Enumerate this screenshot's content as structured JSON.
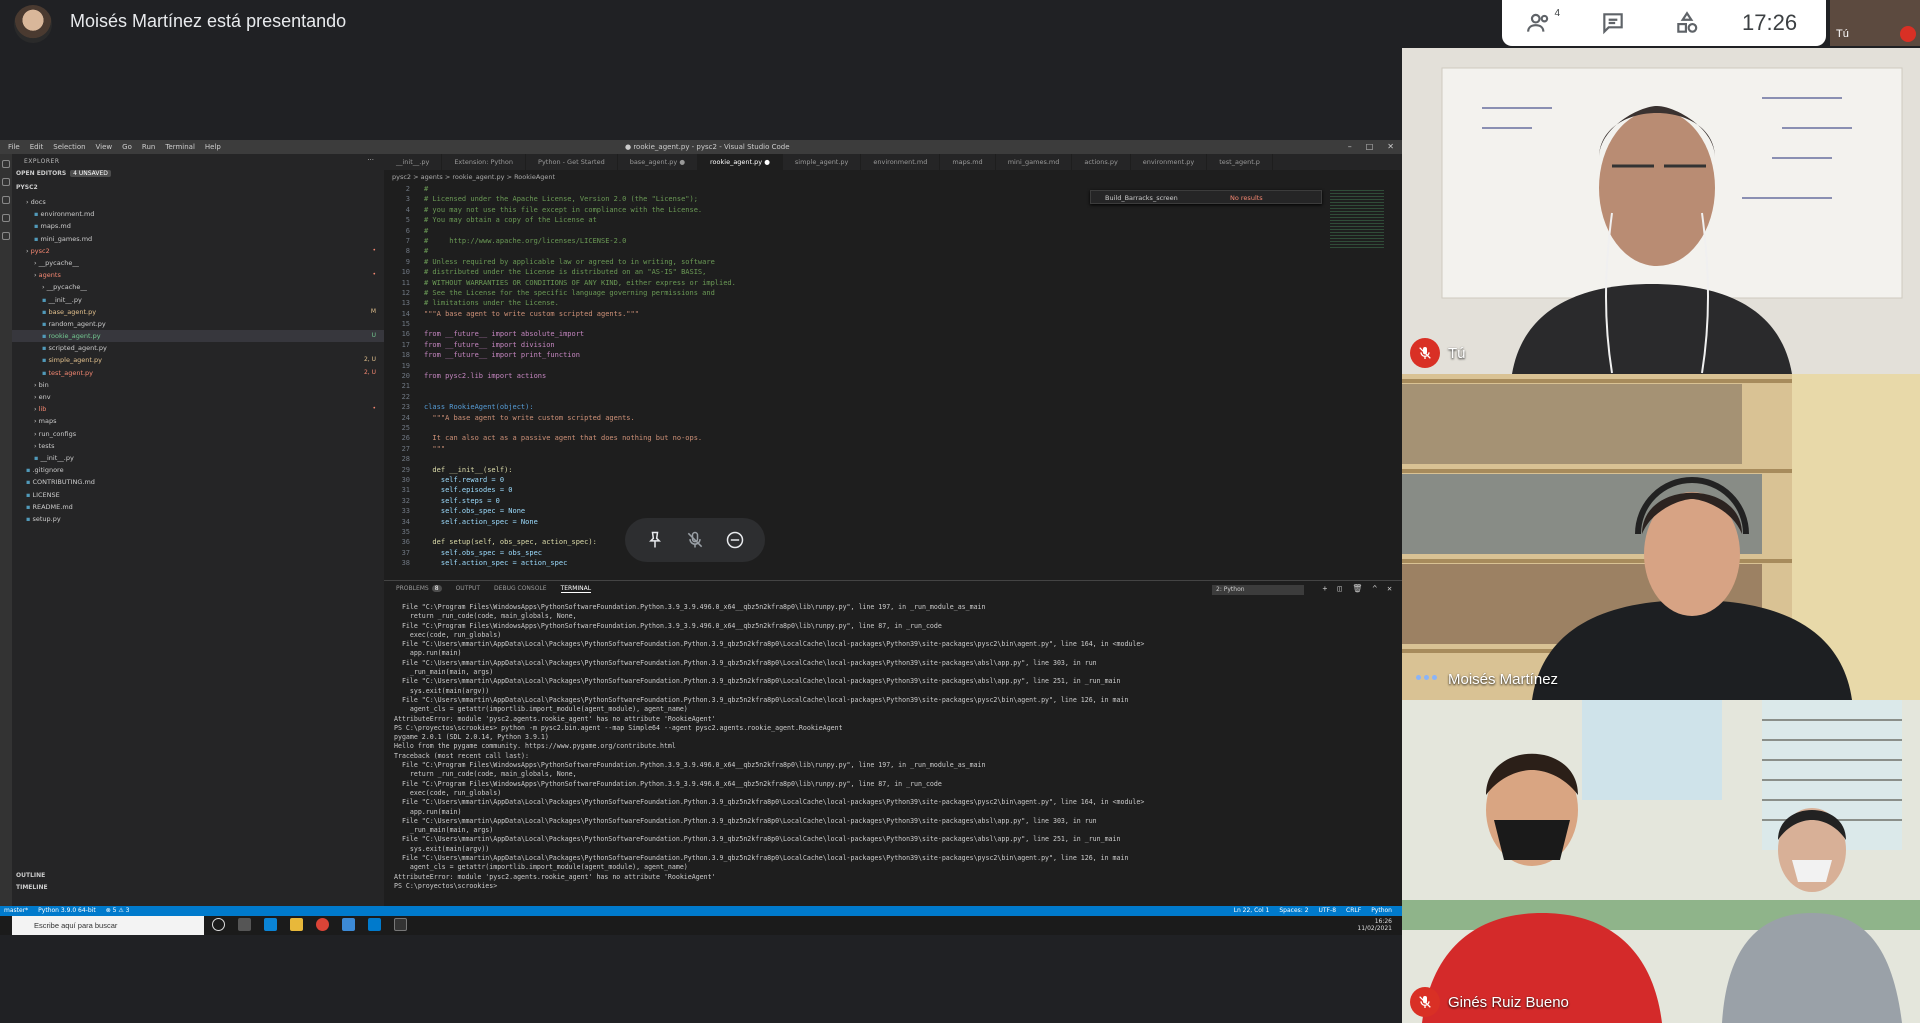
{
  "meeting": {
    "presenter_title": "Moisés Martínez está presentando",
    "participant_count": "4",
    "clock": "17:26",
    "self_thumb_label": "Tú"
  },
  "participants": [
    {
      "name": "Tú",
      "muted": true,
      "speaking": false
    },
    {
      "name": "Moisés Martínez",
      "muted": false,
      "speaking": true
    },
    {
      "name": "Ginés Ruiz Bueno",
      "muted": true,
      "speaking": false
    }
  ],
  "vscode": {
    "menu": [
      "File",
      "Edit",
      "Selection",
      "View",
      "Go",
      "Run",
      "Terminal",
      "Help"
    ],
    "window_title": "● rookie_agent.py - pysc2 - Visual Studio Code",
    "explorer_title": "EXPLORER",
    "open_editors_label": "OPEN EDITORS",
    "unsaved_label": "4 UNSAVED",
    "root_folder": "PYSC2",
    "tree": [
      {
        "label": "docs",
        "indent": 1,
        "type": "folder",
        "color": "#cccccc",
        "badge": ""
      },
      {
        "label": "environment.md",
        "indent": 2,
        "type": "file",
        "color": "#cccccc",
        "badge": ""
      },
      {
        "label": "maps.md",
        "indent": 2,
        "type": "file",
        "color": "#cccccc",
        "badge": ""
      },
      {
        "label": "mini_games.md",
        "indent": 2,
        "type": "file",
        "color": "#cccccc",
        "badge": ""
      },
      {
        "label": "pysc2",
        "indent": 1,
        "type": "folder",
        "color": "#f48771",
        "badge": "•"
      },
      {
        "label": "__pycache__",
        "indent": 2,
        "type": "folder",
        "color": "#cccccc",
        "badge": ""
      },
      {
        "label": "agents",
        "indent": 2,
        "type": "folder",
        "color": "#f48771",
        "badge": "•"
      },
      {
        "label": "__pycache__",
        "indent": 3,
        "type": "folder",
        "color": "#cccccc",
        "badge": ""
      },
      {
        "label": "__init__.py",
        "indent": 3,
        "type": "file",
        "color": "#cccccc",
        "badge": ""
      },
      {
        "label": "base_agent.py",
        "indent": 3,
        "type": "file",
        "color": "#e2c08d",
        "badge": "M"
      },
      {
        "label": "random_agent.py",
        "indent": 3,
        "type": "file",
        "color": "#cccccc",
        "badge": ""
      },
      {
        "label": "rookie_agent.py",
        "indent": 3,
        "type": "file",
        "color": "#73c991",
        "badge": "U",
        "selected": true
      },
      {
        "label": "scripted_agent.py",
        "indent": 3,
        "type": "file",
        "color": "#cccccc",
        "badge": ""
      },
      {
        "label": "simple_agent.py",
        "indent": 3,
        "type": "file",
        "color": "#e2c08d",
        "badge": "2, U"
      },
      {
        "label": "test_agent.py",
        "indent": 3,
        "type": "file",
        "color": "#f48771",
        "badge": "2, U"
      },
      {
        "label": "bin",
        "indent": 2,
        "type": "folder",
        "color": "#cccccc",
        "badge": ""
      },
      {
        "label": "env",
        "indent": 2,
        "type": "folder",
        "color": "#cccccc",
        "badge": ""
      },
      {
        "label": "lib",
        "indent": 2,
        "type": "folder",
        "color": "#f48771",
        "badge": "•"
      },
      {
        "label": "maps",
        "indent": 2,
        "type": "folder",
        "color": "#cccccc",
        "badge": ""
      },
      {
        "label": "run_configs",
        "indent": 2,
        "type": "folder",
        "color": "#cccccc",
        "badge": ""
      },
      {
        "label": "tests",
        "indent": 2,
        "type": "folder",
        "color": "#cccccc",
        "badge": ""
      },
      {
        "label": "__init__.py",
        "indent": 2,
        "type": "file",
        "color": "#cccccc",
        "badge": ""
      },
      {
        "label": ".gitignore",
        "indent": 1,
        "type": "file",
        "color": "#cccccc",
        "badge": ""
      },
      {
        "label": "CONTRIBUTING.md",
        "indent": 1,
        "type": "file",
        "color": "#cccccc",
        "badge": ""
      },
      {
        "label": "LICENSE",
        "indent": 1,
        "type": "file",
        "color": "#cccccc",
        "badge": ""
      },
      {
        "label": "README.md",
        "indent": 1,
        "type": "file",
        "color": "#cccccc",
        "badge": ""
      },
      {
        "label": "setup.py",
        "indent": 1,
        "type": "file",
        "color": "#cccccc",
        "badge": ""
      }
    ],
    "outline_label": "OUTLINE",
    "timeline_label": "TIMELINE",
    "tabs": [
      {
        "label": "__init__.py",
        "active": false
      },
      {
        "label": "Extension: Python",
        "active": false
      },
      {
        "label": "Python - Get Started",
        "active": false
      },
      {
        "label": "base_agent.py ●",
        "active": false
      },
      {
        "label": "rookie_agent.py ●",
        "active": true
      },
      {
        "label": "simple_agent.py",
        "active": false
      },
      {
        "label": "environment.md",
        "active": false
      },
      {
        "label": "maps.md",
        "active": false
      },
      {
        "label": "mini_games.md",
        "active": false
      },
      {
        "label": "actions.py",
        "active": false
      },
      {
        "label": "environment.py",
        "active": false
      },
      {
        "label": "test_agent.p",
        "active": false
      }
    ],
    "breadcrumb": "pysc2 > agents > rookie_agent.py > RookieAgent",
    "find_text": "Build_Barracks_screen",
    "find_result": "No results",
    "code_lines": [
      {
        "n": "2",
        "text": "#",
        "color": "#6a9955"
      },
      {
        "n": "3",
        "text": "# Licensed under the Apache License, Version 2.0 (the \"License\");",
        "color": "#6a9955"
      },
      {
        "n": "4",
        "text": "# you may not use this file except in compliance with the License.",
        "color": "#6a9955"
      },
      {
        "n": "5",
        "text": "# You may obtain a copy of the License at",
        "color": "#6a9955"
      },
      {
        "n": "6",
        "text": "#",
        "color": "#6a9955"
      },
      {
        "n": "7",
        "text": "#     http://www.apache.org/licenses/LICENSE-2.0",
        "color": "#6a9955"
      },
      {
        "n": "8",
        "text": "#",
        "color": "#6a9955"
      },
      {
        "n": "9",
        "text": "# Unless required by applicable law or agreed to in writing, software",
        "color": "#6a9955"
      },
      {
        "n": "10",
        "text": "# distributed under the License is distributed on an \"AS-IS\" BASIS,",
        "color": "#6a9955"
      },
      {
        "n": "11",
        "text": "# WITHOUT WARRANTIES OR CONDITIONS OF ANY KIND, either express or implied.",
        "color": "#6a9955"
      },
      {
        "n": "12",
        "text": "# See the License for the specific language governing permissions and",
        "color": "#6a9955"
      },
      {
        "n": "13",
        "text": "# limitations under the License.",
        "color": "#6a9955"
      },
      {
        "n": "14",
        "text": "\"\"\"A base agent to write custom scripted agents.\"\"\"",
        "color": "#ce9178"
      },
      {
        "n": "15",
        "text": "",
        "color": "#d4d4d4"
      },
      {
        "n": "16",
        "text": "from __future__ import absolute_import",
        "color": "#c586c0"
      },
      {
        "n": "17",
        "text": "from __future__ import division",
        "color": "#c586c0"
      },
      {
        "n": "18",
        "text": "from __future__ import print_function",
        "color": "#c586c0"
      },
      {
        "n": "19",
        "text": "",
        "color": "#d4d4d4"
      },
      {
        "n": "20",
        "text": "from pysc2.lib import actions",
        "color": "#c586c0"
      },
      {
        "n": "21",
        "text": "",
        "color": "#d4d4d4"
      },
      {
        "n": "22",
        "text": "",
        "color": "#d4d4d4"
      },
      {
        "n": "23",
        "text": "class RookieAgent(object):",
        "color": "#569cd6"
      },
      {
        "n": "24",
        "text": "  \"\"\"A base agent to write custom scripted agents.",
        "color": "#ce9178"
      },
      {
        "n": "25",
        "text": "",
        "color": "#d4d4d4"
      },
      {
        "n": "26",
        "text": "  It can also act as a passive agent that does nothing but no-ops.",
        "color": "#ce9178"
      },
      {
        "n": "27",
        "text": "  \"\"\"",
        "color": "#ce9178"
      },
      {
        "n": "28",
        "text": "",
        "color": "#d4d4d4"
      },
      {
        "n": "29",
        "text": "  def __init__(self):",
        "color": "#dcdcaa"
      },
      {
        "n": "30",
        "text": "    self.reward = 0",
        "color": "#9cdcfe"
      },
      {
        "n": "31",
        "text": "    self.episodes = 0",
        "color": "#9cdcfe"
      },
      {
        "n": "32",
        "text": "    self.steps = 0",
        "color": "#9cdcfe"
      },
      {
        "n": "33",
        "text": "    self.obs_spec = None",
        "color": "#9cdcfe"
      },
      {
        "n": "34",
        "text": "    self.action_spec = None",
        "color": "#9cdcfe"
      },
      {
        "n": "35",
        "text": "",
        "color": "#d4d4d4"
      },
      {
        "n": "36",
        "text": "  def setup(self, obs_spec, action_spec):",
        "color": "#dcdcaa"
      },
      {
        "n": "37",
        "text": "    self.obs_spec = obs_spec",
        "color": "#9cdcfe"
      },
      {
        "n": "38",
        "text": "    self.action_spec = action_spec",
        "color": "#9cdcfe"
      }
    ],
    "panel_tabs": [
      "PROBLEMS",
      "OUTPUT",
      "DEBUG CONSOLE",
      "TERMINAL"
    ],
    "problems_count": "8",
    "terminal_select": "2: Python",
    "terminal_lines": [
      "  File \"C:\\Program Files\\WindowsApps\\PythonSoftwareFoundation.Python.3.9_3.9.496.0_x64__qbz5n2kfra8p0\\lib\\runpy.py\", line 197, in _run_module_as_main",
      "    return _run_code(code, main_globals, None,",
      "  File \"C:\\Program Files\\WindowsApps\\PythonSoftwareFoundation.Python.3.9_3.9.496.0_x64__qbz5n2kfra8p0\\lib\\runpy.py\", line 87, in _run_code",
      "    exec(code, run_globals)",
      "  File \"C:\\Users\\mmartin\\AppData\\Local\\Packages\\PythonSoftwareFoundation.Python.3.9_qbz5n2kfra8p0\\LocalCache\\local-packages\\Python39\\site-packages\\pysc2\\bin\\agent.py\", line 164, in <module>",
      "    app.run(main)",
      "  File \"C:\\Users\\mmartin\\AppData\\Local\\Packages\\PythonSoftwareFoundation.Python.3.9_qbz5n2kfra8p0\\LocalCache\\local-packages\\Python39\\site-packages\\absl\\app.py\", line 303, in run",
      "    _run_main(main, args)",
      "  File \"C:\\Users\\mmartin\\AppData\\Local\\Packages\\PythonSoftwareFoundation.Python.3.9_qbz5n2kfra8p0\\LocalCache\\local-packages\\Python39\\site-packages\\absl\\app.py\", line 251, in _run_main",
      "    sys.exit(main(argv))",
      "  File \"C:\\Users\\mmartin\\AppData\\Local\\Packages\\PythonSoftwareFoundation.Python.3.9_qbz5n2kfra8p0\\LocalCache\\local-packages\\Python39\\site-packages\\pysc2\\bin\\agent.py\", line 126, in main",
      "    agent_cls = getattr(importlib.import_module(agent_module), agent_name)",
      "AttributeError: module 'pysc2.agents.rookie_agent' has no attribute 'RookieAgent'",
      "PS C:\\proyectos\\scrookies> python -m pysc2.bin.agent --map Simple64 --agent pysc2.agents.rookie_agent.RookieAgent",
      "pygame 2.0.1 (SDL 2.0.14, Python 3.9.1)",
      "Hello from the pygame community. https://www.pygame.org/contribute.html",
      "Traceback (most recent call last):",
      "  File \"C:\\Program Files\\WindowsApps\\PythonSoftwareFoundation.Python.3.9_3.9.496.0_x64__qbz5n2kfra8p0\\lib\\runpy.py\", line 197, in _run_module_as_main",
      "    return _run_code(code, main_globals, None,",
      "  File \"C:\\Program Files\\WindowsApps\\PythonSoftwareFoundation.Python.3.9_3.9.496.0_x64__qbz5n2kfra8p0\\lib\\runpy.py\", line 87, in _run_code",
      "    exec(code, run_globals)",
      "  File \"C:\\Users\\mmartin\\AppData\\Local\\Packages\\PythonSoftwareFoundation.Python.3.9_qbz5n2kfra8p0\\LocalCache\\local-packages\\Python39\\site-packages\\pysc2\\bin\\agent.py\", line 164, in <module>",
      "    app.run(main)",
      "  File \"C:\\Users\\mmartin\\AppData\\Local\\Packages\\PythonSoftwareFoundation.Python.3.9_qbz5n2kfra8p0\\LocalCache\\local-packages\\Python39\\site-packages\\absl\\app.py\", line 303, in run",
      "    _run_main(main, args)",
      "  File \"C:\\Users\\mmartin\\AppData\\Local\\Packages\\PythonSoftwareFoundation.Python.3.9_qbz5n2kfra8p0\\LocalCache\\local-packages\\Python39\\site-packages\\absl\\app.py\", line 251, in _run_main",
      "    sys.exit(main(argv))",
      "  File \"C:\\Users\\mmartin\\AppData\\Local\\Packages\\PythonSoftwareFoundation.Python.3.9_qbz5n2kfra8p0\\LocalCache\\local-packages\\Python39\\site-packages\\pysc2\\bin\\agent.py\", line 126, in main",
      "    agent_cls = getattr(importlib.import_module(agent_module), agent_name)",
      "AttributeError: module 'pysc2.agents.rookie_agent' has no attribute 'RookieAgent'",
      "PS C:\\proyectos\\scrookies> "
    ],
    "status_left": [
      "master*",
      "Python 3.9.0 64-bit",
      "⊗ 5 ⚠ 3"
    ],
    "status_right": [
      "Ln 22, Col 1",
      "Spaces: 2",
      "UTF-8",
      "CRLF",
      "Python"
    ],
    "taskbar_search": "Escribe aquí para buscar",
    "tray_time": "16:26",
    "tray_date": "11/02/2021"
  },
  "colors": {
    "meet_bg": "#202124",
    "mute_red": "#d93025",
    "vscode_accent": "#007acc"
  }
}
